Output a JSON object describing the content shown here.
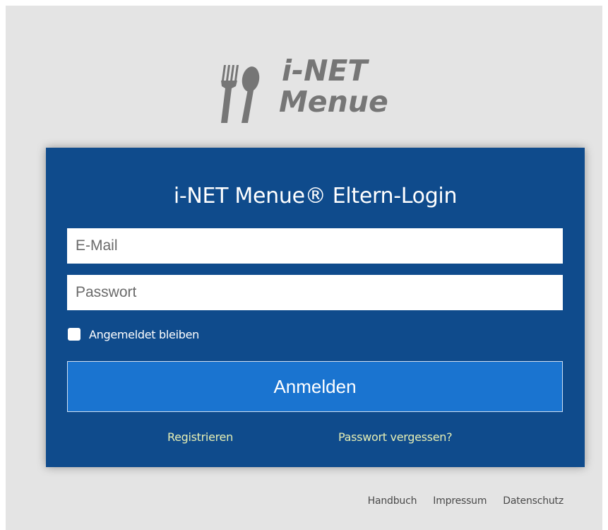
{
  "logo": {
    "line1": "i-NET",
    "line2": "Menue"
  },
  "login": {
    "title": "i-NET Menue® Eltern-Login",
    "email_placeholder": "E-Mail",
    "password_placeholder": "Passwort",
    "remember_label": "Angemeldet bleiben",
    "remember_checked": false,
    "submit_label": "Anmelden",
    "register_link": "Registrieren",
    "forgot_link": "Passwort vergessen?"
  },
  "footer": {
    "links": [
      "Handbuch",
      "Impressum",
      "Datenschutz"
    ]
  },
  "colors": {
    "background": "#e4e4e4",
    "card": "#0f4b8c",
    "button": "#1a74d0",
    "link": "#e6efb4",
    "logo": "#767676"
  },
  "icons": {
    "logo_mark": "cutlery-icon"
  }
}
